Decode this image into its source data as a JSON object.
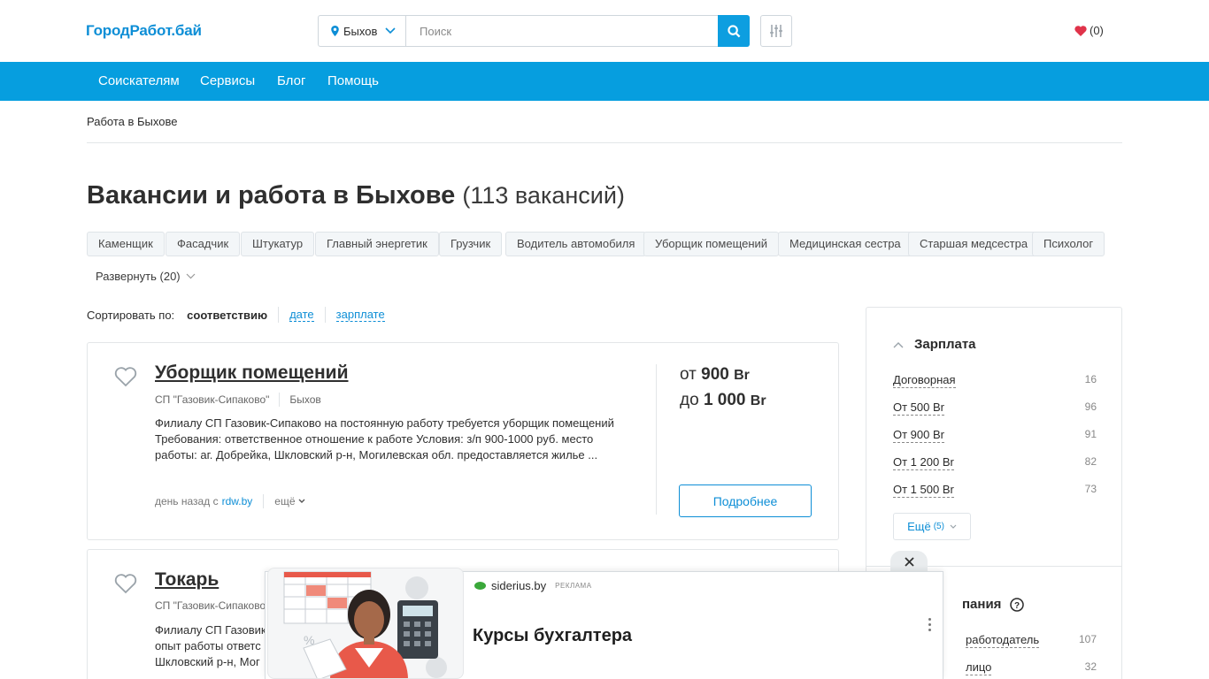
{
  "header": {
    "logo": "ГородРабот.бай",
    "city": "Быхов",
    "search_placeholder": "Поиск",
    "favorites_count": "(0)"
  },
  "nav": [
    "Соискателям",
    "Сервисы",
    "Блог",
    "Помощь"
  ],
  "breadcrumb": "Работа в Быхове",
  "page": {
    "title": "Вакансии и работа в Быхове",
    "count": "(113 вакансий)"
  },
  "tags": [
    "Каменщик",
    "Фасадчик",
    "Штукатур",
    "Главный энергетик",
    "Грузчик",
    "Водитель автомобиля",
    "Уборщик помещений",
    "Медицинская сестра",
    "Старшая медсестра",
    "Психолог"
  ],
  "expand_label": "Развернуть (20)",
  "sort": {
    "label": "Сортировать по:",
    "active": "соответствию",
    "options": [
      "дате",
      "зарплате"
    ]
  },
  "vacancies": [
    {
      "title": "Уборщик помещений",
      "company": "СП \"Газовик-Сипаково\"",
      "city": "Быхов",
      "description": "Филиалу СП Газовик-Сипаково на постоянную работу требуется уборщик помещений Требования: ответственное отношение к работе Условия: з/п 900-1000 руб. место работы: аг. Добрейка, Шкловский р-н, Могилевская обл. предоставляется жилье ...",
      "posted": "день назад с",
      "source": "rdw.by",
      "more": "ещё",
      "salary_from_prefix": "от",
      "salary_from": "900",
      "salary_to_prefix": "до",
      "salary_to": "1 000",
      "currency": "Br",
      "button": "Подробнее"
    },
    {
      "title": "Токарь",
      "company": "СП \"Газовик-Сипаково\"",
      "desc_line1": "Филиалу СП Газовик",
      "desc_line2": "опыт работы ответс",
      "desc_line3": "Шкловский р-н, Мог"
    }
  ],
  "sidebar": {
    "salary_title": "Зарплата",
    "salary_items": [
      {
        "label": "Договорная",
        "count": "16"
      },
      {
        "label": "От 500 Br",
        "count": "96"
      },
      {
        "label": "От 900 Br",
        "count": "91"
      },
      {
        "label": "От 1 200 Br",
        "count": "82"
      },
      {
        "label": "От 1 500 Br",
        "count": "73"
      }
    ],
    "more_label": "Ещё",
    "more_count": "(5)",
    "company_title_partial": "пания",
    "company_items": [
      {
        "label": "работодатель",
        "count": "107"
      },
      {
        "label": "лицо",
        "count": "32"
      }
    ]
  },
  "ad": {
    "domain": "siderius.by",
    "label": "РЕКЛАМА",
    "title": "Курсы бухгалтера"
  },
  "colors": {
    "brand": "#069edf",
    "link": "#0d8ed6",
    "heart": "#e0334a"
  }
}
